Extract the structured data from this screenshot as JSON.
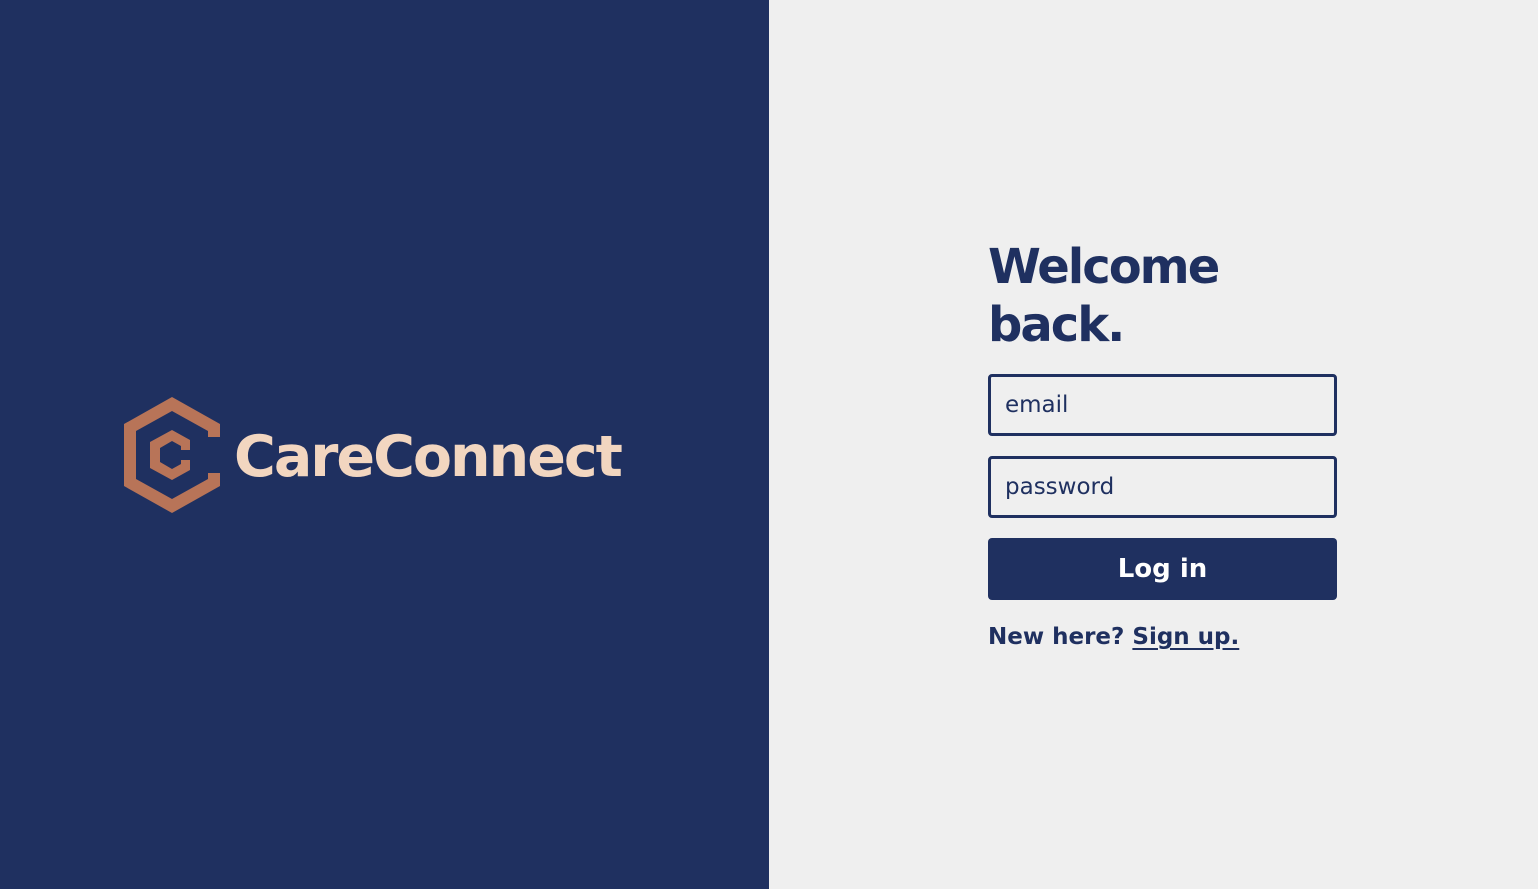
{
  "brand": {
    "name": "CareConnect",
    "logo_icon": "hexagon-c-logo-icon",
    "name_color": "#f2d6c0",
    "mark_color": "#b87458"
  },
  "colors": {
    "primary": "#1f3060",
    "background": "#efefef"
  },
  "login": {
    "heading": "Welcome back.",
    "email_placeholder": "email",
    "password_placeholder": "password",
    "submit_label": "Log in",
    "signup_prompt": "New here?",
    "signup_link": "Sign up."
  }
}
